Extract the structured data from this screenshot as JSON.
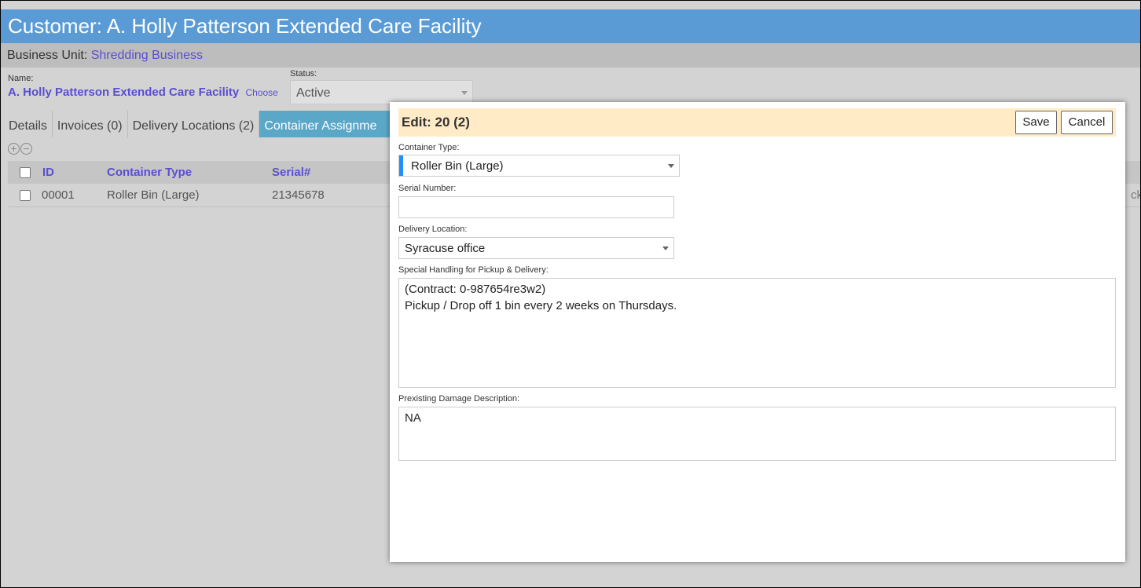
{
  "header": {
    "title": "Customer: A. Holly Patterson Extended Care Facility"
  },
  "business_unit": {
    "label": "Business Unit:",
    "value": "Shredding Business"
  },
  "form": {
    "name_label": "Name:",
    "name_value": "A. Holly Patterson Extended Care Facility",
    "choose_label": "Choose",
    "status_label": "Status:",
    "status_value": "Active"
  },
  "tabs": [
    {
      "label": "Details"
    },
    {
      "label": "Invoices (0)"
    },
    {
      "label": "Delivery Locations (2)"
    },
    {
      "label": "Container Assignme"
    }
  ],
  "grid": {
    "columns": [
      "ID",
      "Container Type",
      "Serial#"
    ],
    "rows": [
      {
        "id": "00001",
        "container_type": "Roller Bin (Large)",
        "serial": "21345678",
        "overflow": "cku"
      }
    ]
  },
  "icons": {
    "add": "plus-circle-icon",
    "remove": "minus-circle-icon"
  },
  "colors": {
    "header": "#5b9bd5",
    "active_tab": "#5aa7c8",
    "link": "#5a4fcf",
    "modal_header": "#ffebc6",
    "required": "#1e90ff"
  },
  "modal": {
    "title": "Edit: 20 (2)",
    "save_label": "Save",
    "cancel_label": "Cancel",
    "container_type_label": "Container Type:",
    "container_type_value": "Roller Bin (Large)",
    "serial_label": "Serial Number:",
    "serial_value": "",
    "delivery_label": "Delivery Location:",
    "delivery_value": "Syracuse office",
    "special_label": "Special Handling for Pickup & Delivery:",
    "special_value": "(Contract: 0-987654re3w2)\nPickup / Drop off 1 bin every 2 weeks on Thursdays.",
    "damage_label": "Prexisting Damage Description:",
    "damage_value": "NA"
  }
}
